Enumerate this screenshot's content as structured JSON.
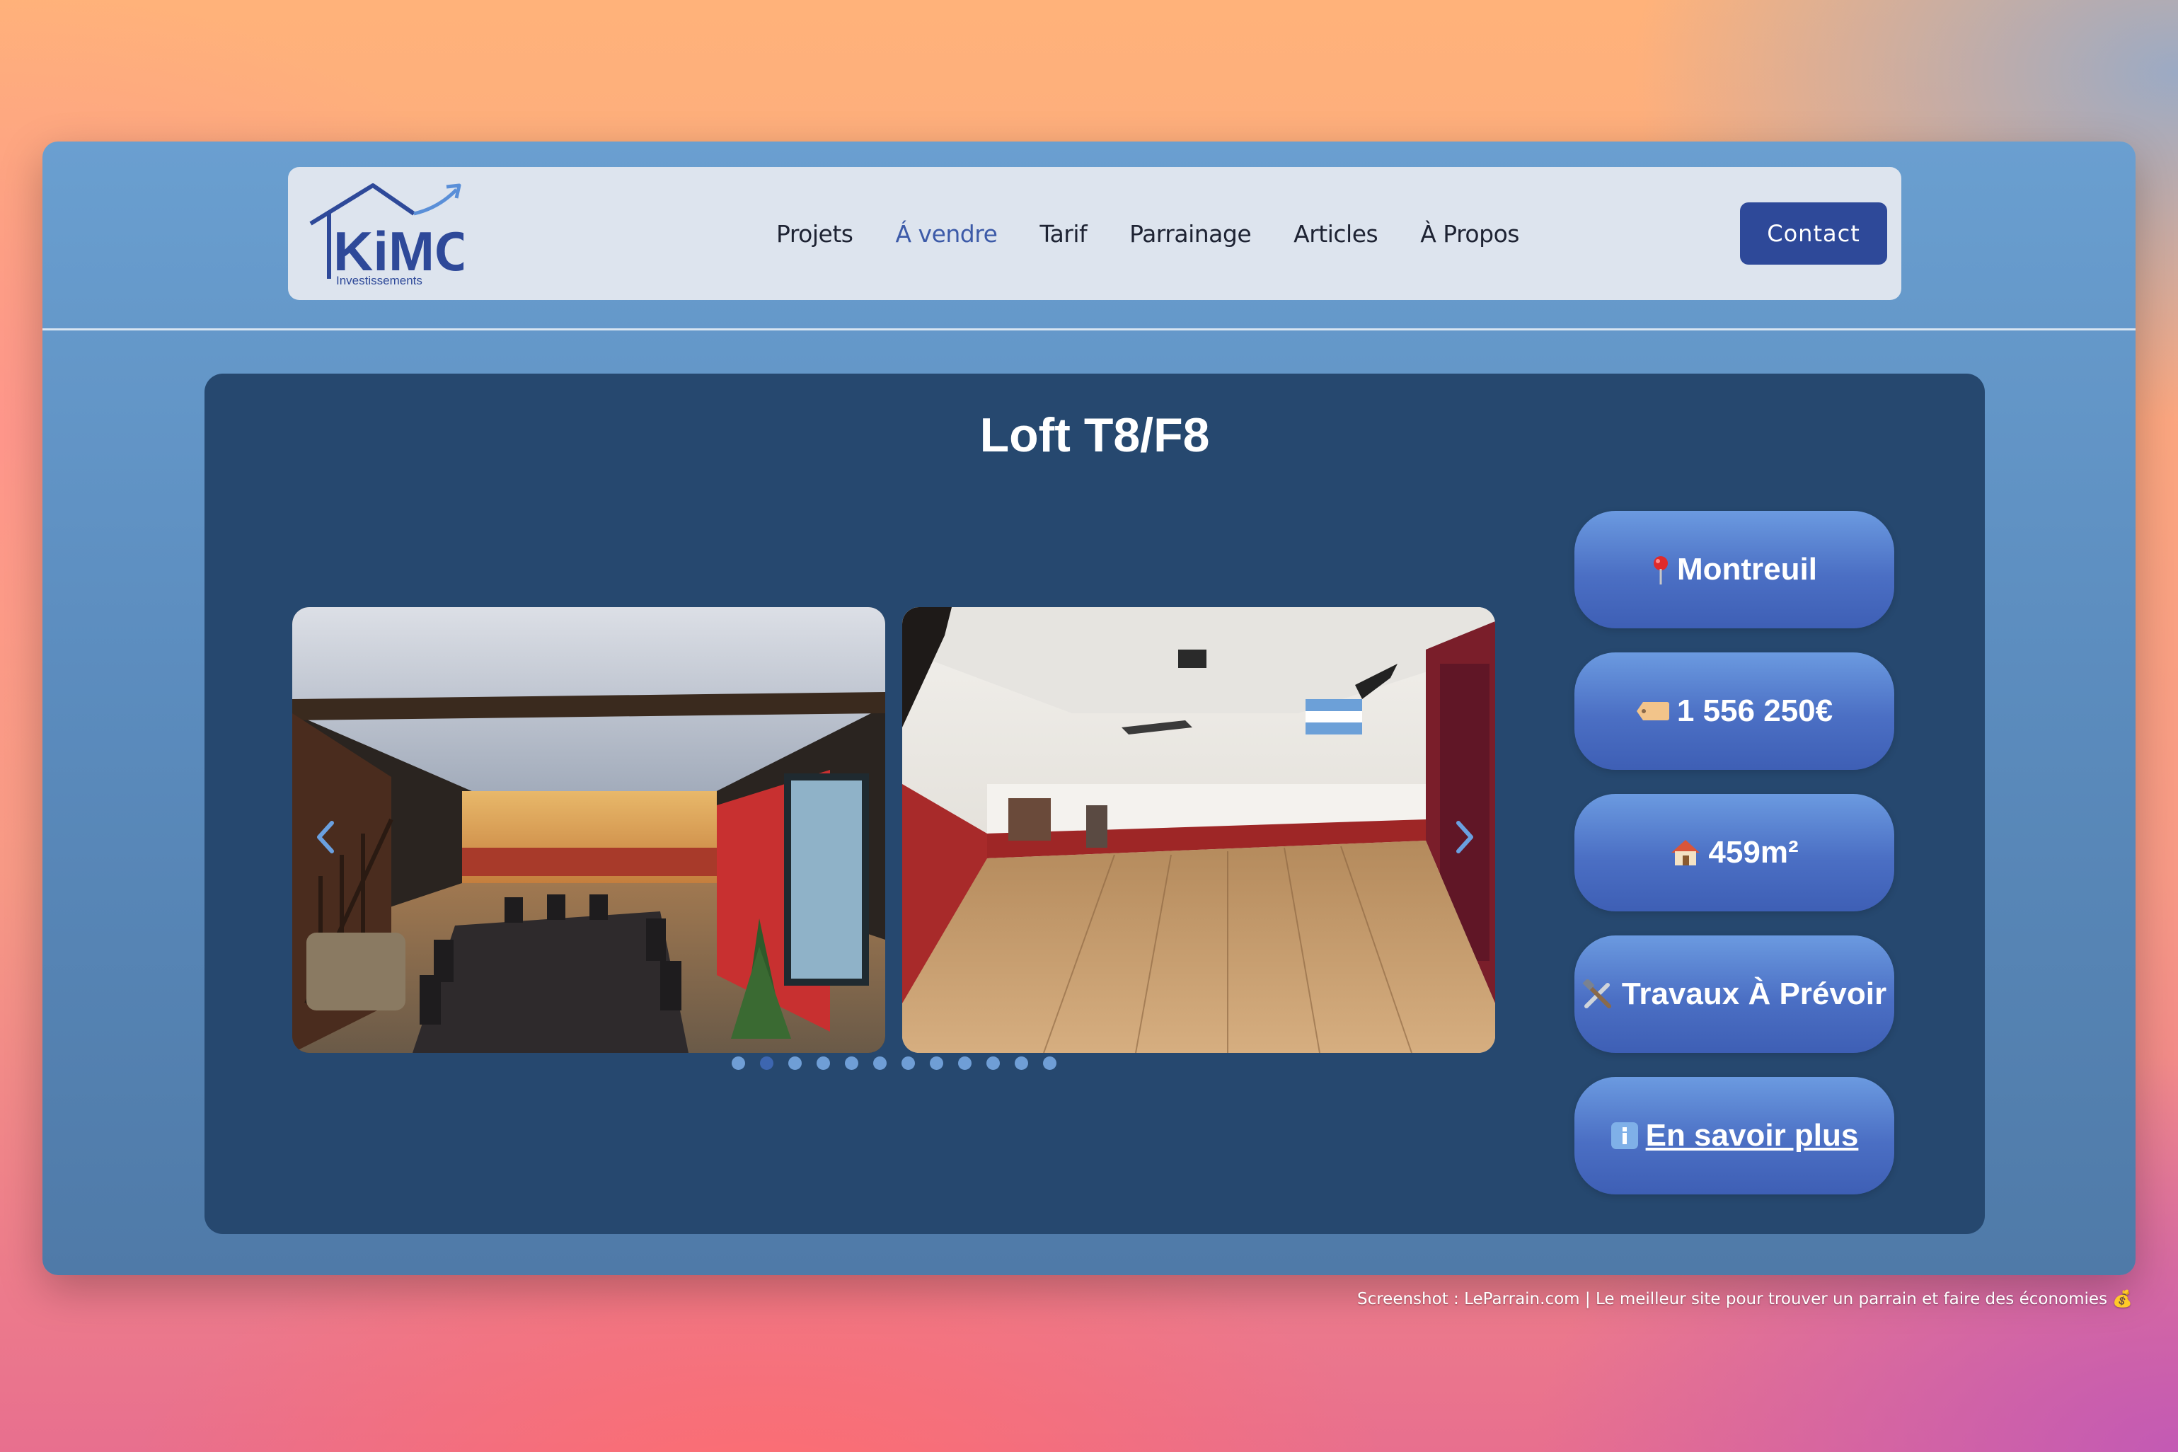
{
  "logo": {
    "brand": "KiMO",
    "tagline": "Investissements",
    "color": "#2e4999"
  },
  "nav": {
    "items": [
      {
        "label": "Projets"
      },
      {
        "label": "Á vendre",
        "active": true
      },
      {
        "label": "Tarif"
      },
      {
        "label": "Parrainage"
      },
      {
        "label": "Articles"
      },
      {
        "label": "À Propos"
      }
    ],
    "contact_label": "Contact"
  },
  "listing": {
    "title": "Loft T8/F8",
    "carousel": {
      "slide_count": 12,
      "active_index": 1,
      "prev_icon": "chevron-left-icon",
      "next_icon": "chevron-right-icon"
    },
    "info": [
      {
        "icon": "pin-icon",
        "text": "Montreuil"
      },
      {
        "icon": "price-tag-icon",
        "text": "1 556 250€"
      },
      {
        "icon": "house-icon",
        "text": "459m²"
      },
      {
        "icon": "tools-icon",
        "text": "Travaux À Prévoir"
      },
      {
        "icon": "info-icon",
        "text": " En savoir plus"
      }
    ]
  },
  "footer_note": "Screenshot : LeParrain.com | Le meilleur site pour trouver un parrain et faire des économies 💰",
  "colors": {
    "card": "#26486f",
    "accent": "#2e4999",
    "nav_bg": "#dde4ee"
  }
}
